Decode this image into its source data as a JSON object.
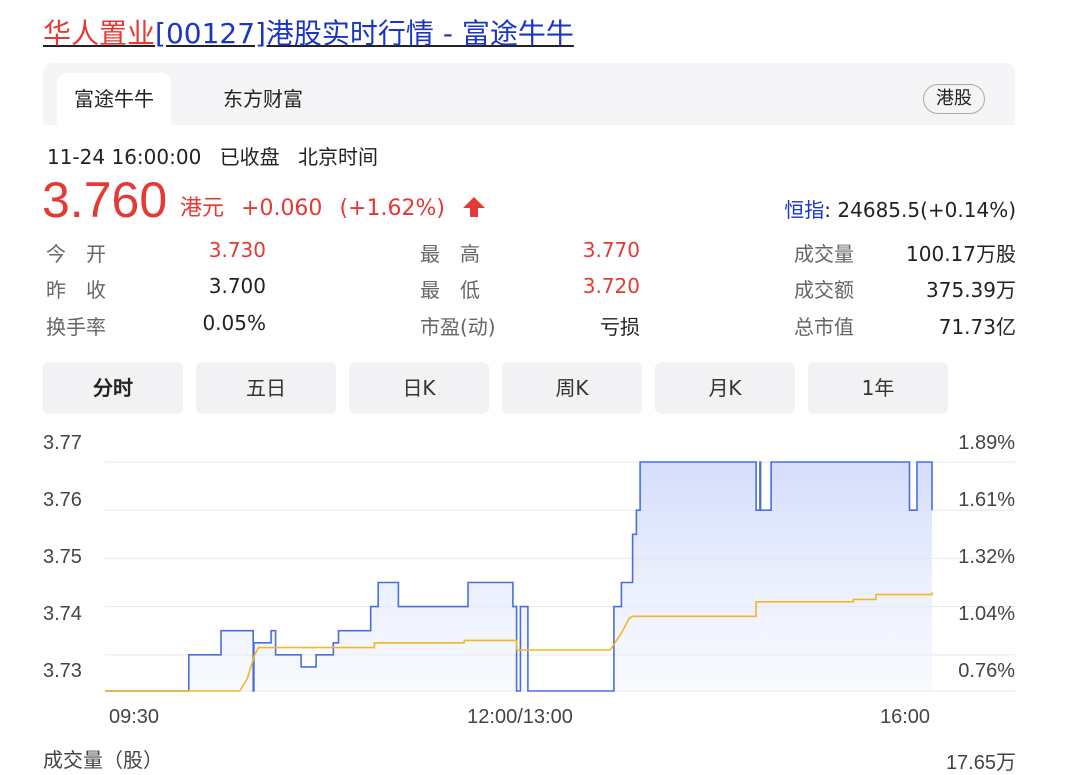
{
  "page_title": {
    "stock_link": "华人置业",
    "rest": "[00127]港股实时行情 - 富途牛牛"
  },
  "source_tabs": [
    {
      "label": "富途牛牛",
      "active": true
    },
    {
      "label": "东方财富",
      "active": false
    }
  ],
  "market_badge": "港股",
  "status": {
    "datetime": "11-24 16:00:00",
    "state": "已收盘",
    "timezone": "北京时间"
  },
  "quote": {
    "price": "3.760",
    "currency": "港元",
    "change": "+0.060",
    "change_pct": "(+1.62%)",
    "direction": "up",
    "up_color": "#e53935"
  },
  "index": {
    "name": "恒指",
    "value": ": 24685.5(+0.14%)"
  },
  "stats": [
    {
      "label": "今　开",
      "value": "3.730",
      "color": "red"
    },
    {
      "label": "最　高",
      "value": "3.770",
      "color": "red"
    },
    {
      "label": "成交量",
      "value": "100.17万股",
      "color": "normal"
    },
    {
      "label": "昨　收",
      "value": "3.700",
      "color": "normal"
    },
    {
      "label": "最　低",
      "value": "3.720",
      "color": "red"
    },
    {
      "label": "成交额",
      "value": "375.39万",
      "color": "normal"
    },
    {
      "label": "换手率",
      "value": "0.05%",
      "color": "normal"
    },
    {
      "label": "市盈(动)",
      "value": "亏损",
      "color": "normal"
    },
    {
      "label": "总市值",
      "value": "71.73亿",
      "color": "normal"
    }
  ],
  "period_tabs": [
    {
      "label": "分时",
      "active": true
    },
    {
      "label": "五日",
      "active": false
    },
    {
      "label": "日K",
      "active": false
    },
    {
      "label": "周K",
      "active": false
    },
    {
      "label": "月K",
      "active": false
    },
    {
      "label": "1年",
      "active": false
    }
  ],
  "chart_data": {
    "type": "line",
    "y_left_ticks": [
      "3.77",
      "3.76",
      "3.75",
      "3.74",
      "3.73"
    ],
    "y_right_ticks": [
      "1.89%",
      "1.61%",
      "1.32%",
      "1.04%",
      "0.76%"
    ],
    "x_ticks": [
      "09:30",
      "12:00/13:00",
      "16:00"
    ],
    "ylim": [
      3.7225,
      3.77
    ],
    "colors": {
      "price": "#4a6ee0",
      "avg": "#f2b824",
      "grid": "#e8e8ec"
    },
    "series": [
      {
        "role": "price",
        "points": [
          [
            0,
            3.7225
          ],
          [
            0.112,
            3.7225
          ],
          [
            0.112,
            3.73
          ],
          [
            0.155,
            3.73
          ],
          [
            0.155,
            3.735
          ],
          [
            0.158,
            3.735
          ],
          [
            0.158,
            3.735
          ],
          [
            0.198,
            3.735
          ],
          [
            0.198,
            3.7225
          ],
          [
            0.199,
            3.7225
          ],
          [
            0.199,
            3.7325
          ],
          [
            0.222,
            3.7325
          ],
          [
            0.222,
            3.735
          ],
          [
            0.228,
            3.735
          ],
          [
            0.228,
            3.73
          ],
          [
            0.262,
            3.73
          ],
          [
            0.262,
            3.7275
          ],
          [
            0.282,
            3.7275
          ],
          [
            0.282,
            3.73
          ],
          [
            0.305,
            3.73
          ],
          [
            0.305,
            3.7325
          ],
          [
            0.312,
            3.7325
          ],
          [
            0.312,
            3.735
          ],
          [
            0.355,
            3.735
          ],
          [
            0.355,
            3.74
          ],
          [
            0.365,
            3.74
          ],
          [
            0.365,
            3.745
          ],
          [
            0.392,
            3.745
          ],
          [
            0.392,
            3.74
          ],
          [
            0.396,
            3.74
          ],
          [
            0.396,
            3.74
          ],
          [
            0.485,
            3.74
          ],
          [
            0.485,
            3.745
          ],
          [
            0.545,
            3.745
          ],
          [
            0.545,
            3.74
          ],
          [
            0.55,
            3.74
          ],
          [
            0.55,
            3.7225
          ],
          [
            0.555,
            3.7225
          ],
          [
            0.555,
            3.74
          ],
          [
            0.565,
            3.74
          ],
          [
            0.565,
            3.7225
          ],
          [
            0.68,
            3.7225
          ],
          [
            0.68,
            3.74
          ],
          [
            0.69,
            3.74
          ],
          [
            0.69,
            3.745
          ],
          [
            0.705,
            3.745
          ],
          [
            0.705,
            3.755
          ],
          [
            0.71,
            3.755
          ],
          [
            0.71,
            3.76
          ],
          [
            0.715,
            3.76
          ],
          [
            0.715,
            3.77
          ],
          [
            0.87,
            3.77
          ],
          [
            0.87,
            3.76
          ],
          [
            0.875,
            3.76
          ],
          [
            0.875,
            3.77
          ],
          [
            0.876,
            3.77
          ],
          [
            0.876,
            3.76
          ],
          [
            0.89,
            3.76
          ],
          [
            0.89,
            3.77
          ],
          [
            1.075,
            3.77
          ],
          [
            1.075,
            3.76
          ],
          [
            1.085,
            3.76
          ],
          [
            1.085,
            3.77
          ],
          [
            1.105,
            3.77
          ],
          [
            1.105,
            3.76
          ]
        ]
      },
      {
        "role": "average",
        "points": [
          [
            0,
            3.7225
          ],
          [
            0.18,
            3.7225
          ],
          [
            0.19,
            3.725
          ],
          [
            0.2,
            3.73
          ],
          [
            0.205,
            3.7315
          ],
          [
            0.36,
            3.7315
          ],
          [
            0.36,
            3.7325
          ],
          [
            0.48,
            3.7325
          ],
          [
            0.48,
            3.733
          ],
          [
            0.55,
            3.733
          ],
          [
            0.55,
            3.731
          ],
          [
            0.675,
            3.731
          ],
          [
            0.69,
            3.7345
          ],
          [
            0.7,
            3.7375
          ],
          [
            0.705,
            3.738
          ],
          [
            0.87,
            3.738
          ],
          [
            0.87,
            3.741
          ],
          [
            1.0,
            3.741
          ],
          [
            1.0,
            3.7415
          ],
          [
            1.03,
            3.7415
          ],
          [
            1.03,
            3.7425
          ],
          [
            1.105,
            3.7425
          ],
          [
            1.105,
            3.743
          ]
        ]
      }
    ]
  },
  "volume": {
    "label": "成交量（股）",
    "max": "17.65万"
  }
}
